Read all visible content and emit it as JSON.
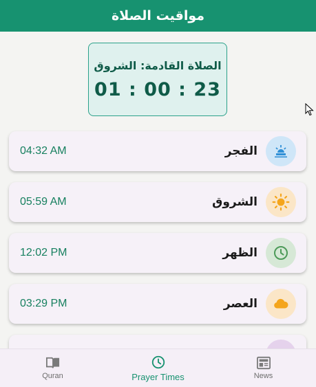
{
  "app": {
    "title": "مواقيت الصلاة"
  },
  "next_prayer": {
    "label": "الصلاة القادمة: الشروق",
    "countdown": "01 : 00 : 23"
  },
  "prayers": [
    {
      "name": "الفجر",
      "time": "04:32 AM",
      "icon": "sunrise-icon",
      "circle_color": "#cfe6f8",
      "icon_color": "#2f8fd6"
    },
    {
      "name": "الشروق",
      "time": "05:59 AM",
      "icon": "sun-icon",
      "circle_color": "#fbe6c7",
      "icon_color": "#f4a51c"
    },
    {
      "name": "الظهر",
      "time": "12:02 PM",
      "icon": "clock-icon",
      "circle_color": "#d6e8d6",
      "icon_color": "#4c9a58"
    },
    {
      "name": "العصر",
      "time": "03:29 PM",
      "icon": "cloud-icon",
      "circle_color": "#fbe6c7",
      "icon_color": "#f4a51c"
    },
    {
      "name": "",
      "time": "",
      "icon": "moon-icon",
      "circle_color": "#e5d2ec",
      "icon_color": "#8c5aa0"
    }
  ],
  "nav": {
    "items": [
      {
        "label": "Quran",
        "icon": "book-icon"
      },
      {
        "label": "Prayer Times",
        "icon": "clock-icon"
      },
      {
        "label": "News",
        "icon": "newspaper-icon"
      }
    ],
    "active_index": 1
  },
  "colors": {
    "primary": "#179270",
    "time_text": "#17805f",
    "card_bg": "#f6f1f8"
  }
}
